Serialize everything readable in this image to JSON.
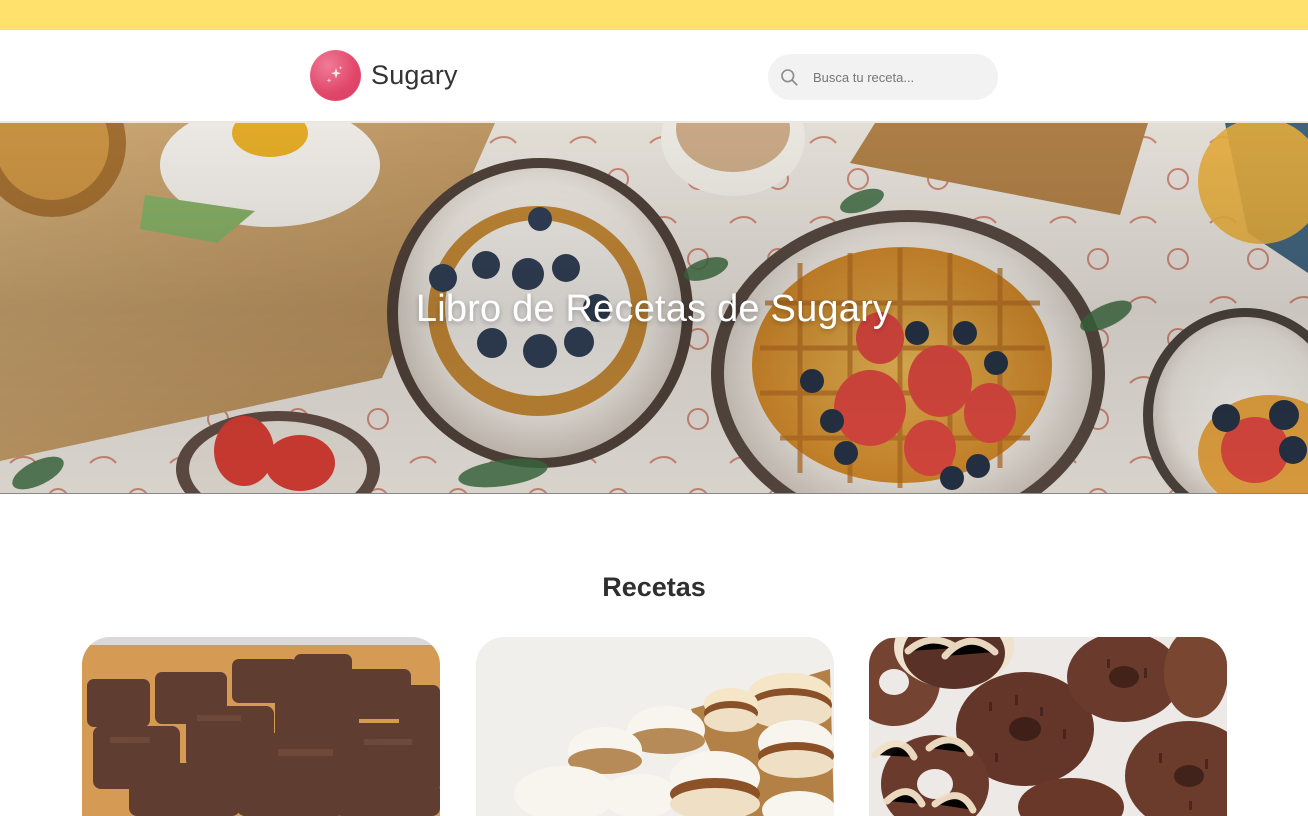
{
  "header": {
    "logo_text": "Sugary",
    "logo_icon": "sparkles-icon",
    "search": {
      "placeholder": "Busca tu receta...",
      "icon": "search-icon"
    }
  },
  "hero": {
    "title": "Libro de Recetas de Sugary"
  },
  "recipes": {
    "title": "Recetas",
    "cards": [
      {
        "image": "brownie-image"
      },
      {
        "image": "alfajor-image"
      },
      {
        "image": "donut-image"
      }
    ]
  },
  "colors": {
    "top_strip": "#ffe16b",
    "logo_accent": "#e1476a",
    "search_background": "#f3f2f2"
  }
}
